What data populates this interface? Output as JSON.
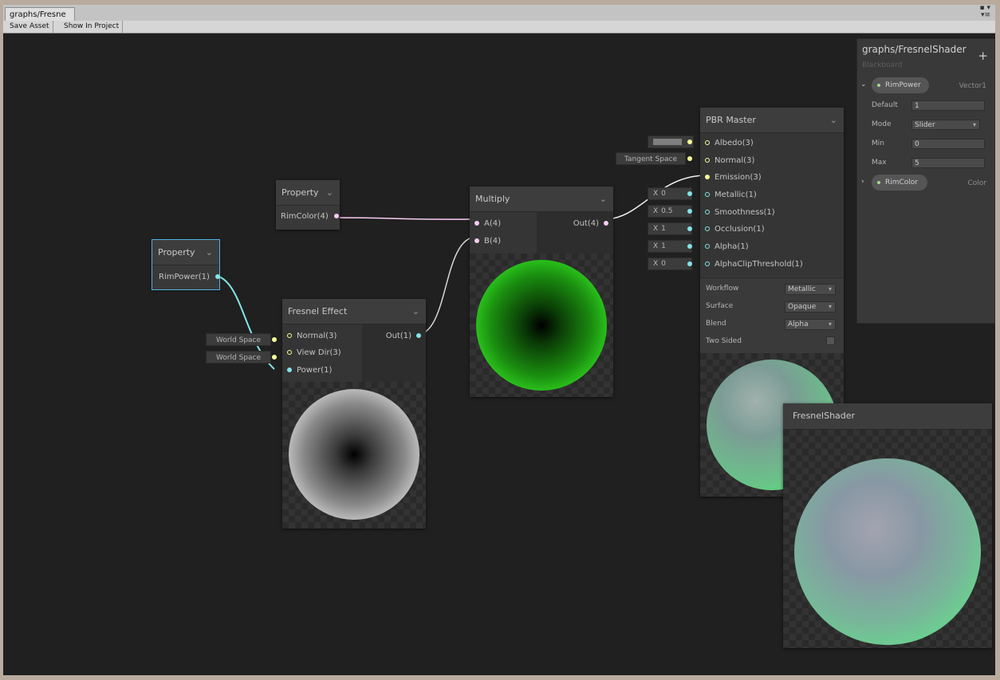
{
  "window": {
    "tab_title": "graphs/Fresne",
    "ctrl_top": "▪ ▾",
    "ctrl_bottom": "▾≡"
  },
  "toolbar": {
    "save_asset": "Save Asset",
    "show_in_project": "Show In Project"
  },
  "nodes": {
    "property_rimcolor": {
      "title": "Property",
      "port": "RimColor(4)"
    },
    "property_rimpower": {
      "title": "Property",
      "port": "RimPower(1)"
    },
    "fresnel": {
      "title": "Fresnel Effect",
      "inputs": [
        "Normal(3)",
        "View Dir(3)",
        "Power(1)"
      ],
      "output": "Out(1)",
      "input_labels": [
        "World Space",
        "World Space"
      ]
    },
    "multiply": {
      "title": "Multiply",
      "inputs": [
        "A(4)",
        "B(4)"
      ],
      "output": "Out(4)"
    },
    "pbr_master": {
      "title": "PBR Master",
      "inputs": [
        "Albedo(3)",
        "Normal(3)",
        "Emission(3)",
        "Metallic(1)",
        "Smoothness(1)",
        "Occlusion(1)",
        "Alpha(1)",
        "AlphaClipThreshold(1)"
      ],
      "input_values": {
        "normal": "Tangent Space",
        "metallic": "0",
        "smoothness": "0.5",
        "occlusion": "1",
        "alpha": "1",
        "alpha_clip": "0",
        "x_label": "X"
      },
      "settings": {
        "workflow_label": "Workflow",
        "workflow_value": "Metallic",
        "surface_label": "Surface",
        "surface_value": "Opaque",
        "blend_label": "Blend",
        "blend_value": "Alpha",
        "two_sided_label": "Two Sided"
      }
    },
    "preview_window": {
      "title": "FresnelShader"
    }
  },
  "blackboard": {
    "title": "graphs/FresnelShader",
    "subtitle": "Blackboard",
    "add": "+",
    "properties": [
      {
        "name": "RimPower",
        "type": "Vector1",
        "expanded": true,
        "fields": {
          "default_label": "Default",
          "default_value": "1",
          "mode_label": "Mode",
          "mode_value": "Slider",
          "min_label": "Min",
          "min_value": "0",
          "max_label": "Max",
          "max_value": "5"
        }
      },
      {
        "name": "RimColor",
        "type": "Color",
        "expanded": false
      }
    ]
  },
  "colors": {
    "accent_selected": "#4fb3e0",
    "port_vector1": "#84e4e7",
    "port_vector3": "#f6ff9a",
    "port_vector4": "#fbcbf4",
    "emission_green": "#3dff2b"
  }
}
